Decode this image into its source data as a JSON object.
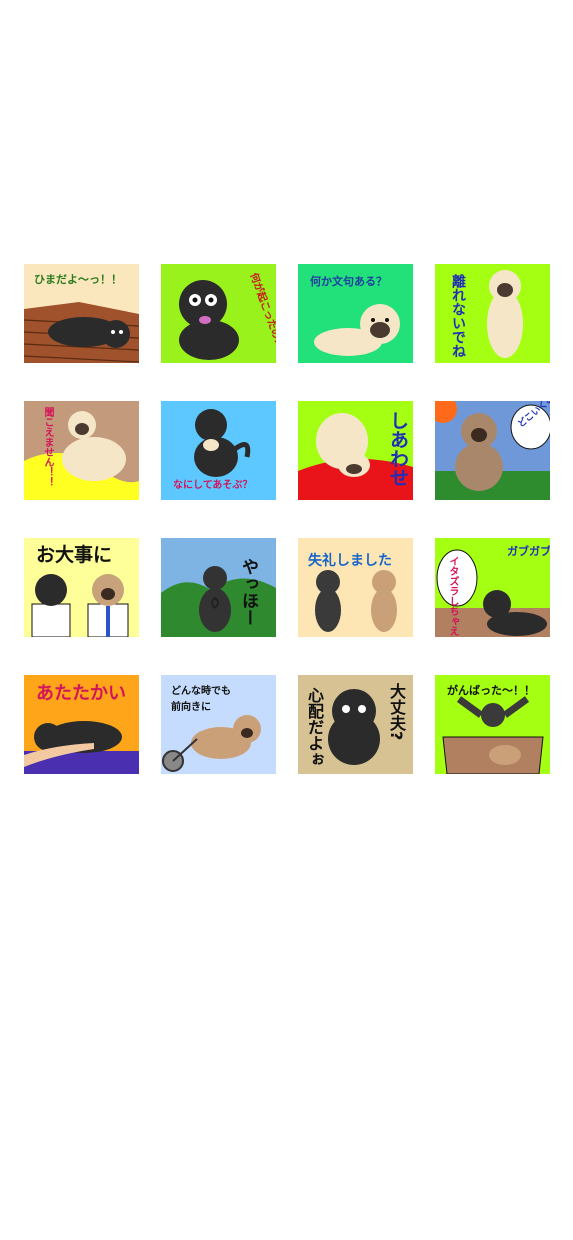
{
  "stickers": [
    {
      "caption": "ひまだよ～っ！！",
      "bg": "#fbe7bd",
      "text_color": "#2a7a1e"
    },
    {
      "caption": "何が起こったの!?",
      "bg": "#99f21c",
      "text_color": "#c6161c"
    },
    {
      "caption": "何か文句ある？",
      "bg": "#22e07a",
      "text_color": "#1d3fa0"
    },
    {
      "caption": "離れないでね",
      "bg": "#a5ff12",
      "text_color": "#1f2fb8"
    },
    {
      "caption": "聞こえません！！",
      "bg": "#c39b7c",
      "text_color": "#d4145a"
    },
    {
      "caption": "なにしてあそぶ？",
      "bg": "#5cc8ff",
      "text_color": "#d4145a"
    },
    {
      "caption": "しあわせ",
      "bg": "#a5ff12",
      "text_color": "#1f2fb8"
    },
    {
      "caption": "どこいくの？",
      "bg": "#6f98d8",
      "text_color": "#1f2fb8"
    },
    {
      "caption": "お大事に",
      "bg": "#ffff99",
      "text_color": "#111111"
    },
    {
      "caption": "やっほー",
      "bg": "#7eb4e4",
      "text_color": "#111111"
    },
    {
      "caption": "失礼しました",
      "bg": "#fde6b3",
      "text_color": "#1765c8"
    },
    {
      "caption_main": "ガブガブ",
      "caption_bubble": "イタズラしちゃえ",
      "bg": "#a5ff12",
      "text_color": "#1f2fb8",
      "bubble_color": "#d4145a"
    },
    {
      "caption": "あたたかい",
      "bg": "#ffa51a",
      "text_color": "#d4145a"
    },
    {
      "caption_line1": "どんな時でも",
      "caption_line2": "前向きに",
      "bg": "#c5dcff",
      "text_color": "#111111"
    },
    {
      "caption_left": "心配だよぉ",
      "caption_right": "大丈夫?",
      "bg": "#d7c294",
      "text_color": "#111111"
    },
    {
      "caption": "がんばった～！！",
      "bg": "#a5ff12",
      "text_color": "#111111"
    }
  ]
}
